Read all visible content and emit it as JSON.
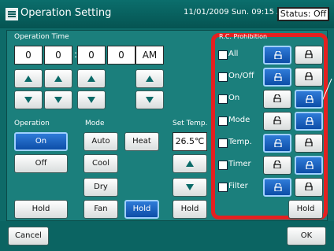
{
  "window": {
    "title": "Operation Setting",
    "datetime": "11/01/2009 Sun. 09:15 AM",
    "status": "Status: Off"
  },
  "operation_time": {
    "label": "Operation Time",
    "fields": [
      "0",
      "0",
      "0",
      "0"
    ],
    "ampm": "AM",
    "up_symbol": "▲",
    "down_symbol": "▼"
  },
  "operation": {
    "label": "Operation",
    "on": "On",
    "off": "Off",
    "hold": "Hold"
  },
  "mode": {
    "label": "Mode",
    "auto": "Auto",
    "heat": "Heat",
    "cool": "Cool",
    "dry": "Dry",
    "fan": "Fan",
    "hold": "Hold"
  },
  "set_temp": {
    "label": "Set Temp.",
    "value": "26.5℃",
    "hold": "Hold"
  },
  "rc_prohibition": {
    "label": "R.C. Prohibition",
    "rows": [
      {
        "label": "All",
        "selected": "left"
      },
      {
        "label": "On/Off",
        "selected": "left"
      },
      {
        "label": "On",
        "selected": "right"
      },
      {
        "label": "Mode",
        "selected": "right"
      },
      {
        "label": "Temp.",
        "selected": "left"
      },
      {
        "label": "Timer",
        "selected": "right"
      },
      {
        "label": "Filter",
        "selected": "left"
      }
    ],
    "hold": "Hold"
  },
  "footer": {
    "cancel": "Cancel",
    "ok": "OK"
  }
}
